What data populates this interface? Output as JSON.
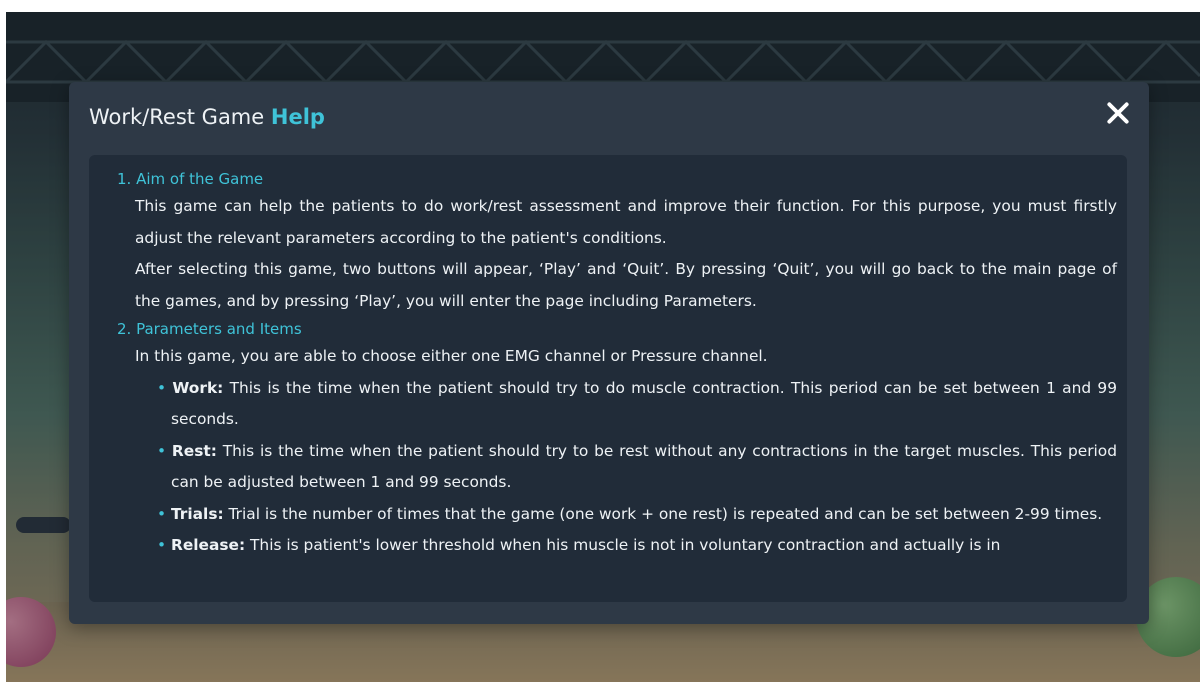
{
  "dialog": {
    "title_prefix": "Work/Rest Game",
    "title_accent": "Help",
    "colors": {
      "accent": "#3fc3d8",
      "panel": "#2e3946",
      "content_bg": "#212c39",
      "text": "#eef2f5"
    },
    "close_icon": "close-icon"
  },
  "sections": [
    {
      "heading": "1. Aim of the Game",
      "paragraphs": [
        "This game can help the patients to do work/rest assessment and improve their function. For this purpose, you must firstly adjust the relevant parameters according to the patient's conditions.",
        "After selecting this game, two buttons will appear, ‘Play’ and ‘Quit’. By pressing ‘Quit’, you will go back to the main page of the games, and by pressing ‘Play’, you will enter the page including Parameters."
      ]
    },
    {
      "heading": "2. Parameters and Items",
      "paragraphs": [
        "In this game, you are able to choose either one EMG channel or Pressure channel."
      ],
      "bullets": [
        {
          "term": "Work:",
          "text": " This is the time when the patient should try to do muscle contraction. This period can be set between 1 and 99 seconds."
        },
        {
          "term": "Rest:",
          "text": " This is the time when the patient should try to be rest without any contractions in the target muscles. This period can be adjusted between 1 and 99 seconds."
        },
        {
          "term": "Trials:",
          "text": " Trial is the number of times that the game (one work + one rest) is repeated and can be set between 2-99 times."
        },
        {
          "term": "Release:",
          "text": " This is patient's lower threshold when his muscle is not in voluntary contraction and actually is in"
        }
      ]
    }
  ]
}
